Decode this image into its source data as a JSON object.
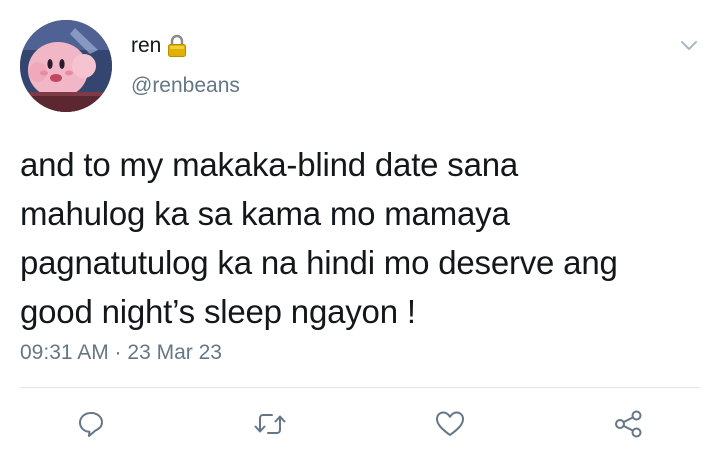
{
  "tweet": {
    "display_name": "ren",
    "handle": "@renbeans",
    "text": "and to my makaka-blind date sana\nmahulog ka sa kama mo mamaya\npagnatutulog ka na hindi mo deserve ang\ngood night’s sleep ngayon !",
    "timestamp": "09:31 AM · 23 Mar 23",
    "protected_icon": "lock-icon",
    "menu_icon": "chevron-down-icon"
  },
  "actions": [
    {
      "name": "reply-button",
      "icon": "reply-icon"
    },
    {
      "name": "retweet-button",
      "icon": "retweet-icon"
    },
    {
      "name": "like-button",
      "icon": "heart-icon"
    },
    {
      "name": "share-button",
      "icon": "share-icon"
    }
  ],
  "colors": {
    "text": "#14171a",
    "secondary": "#657786",
    "divider": "#e1e8ed",
    "icon": "#657786",
    "lock": "#e0b100"
  }
}
